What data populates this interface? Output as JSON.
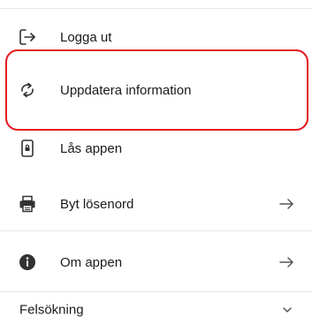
{
  "menu": {
    "items": [
      {
        "label": "Logga ut",
        "icon": "logout-icon"
      },
      {
        "label": "Uppdatera information",
        "icon": "refresh-icon"
      },
      {
        "label": "Lås appen",
        "icon": "lock-phone-icon"
      },
      {
        "label": "Byt lösenord",
        "icon": "printer-icon"
      },
      {
        "label": "Om appen",
        "icon": "info-icon"
      }
    ],
    "footer_label": "Felsökning"
  },
  "colors": {
    "highlight": "#e5161e",
    "text": "#1a1a1a",
    "divider": "#e6e6e6"
  }
}
